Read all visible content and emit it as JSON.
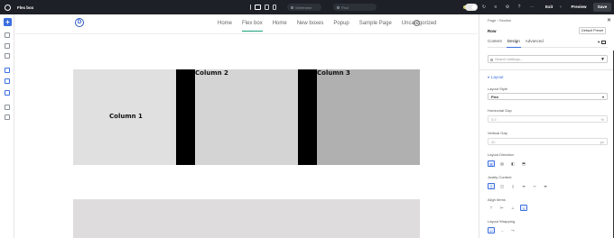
{
  "topbar": {
    "page_name": "Flex box",
    "wireframe_label": "Wireframe",
    "find_label": "Find",
    "exit_label": "Exit",
    "preview_label": "Preview",
    "save_label": "Save"
  },
  "site": {
    "logo_letter": "D",
    "nav": [
      "Home",
      "Flex box",
      "Home",
      "New boxes",
      "Popup",
      "Sample Page",
      "Uncategorized"
    ],
    "active_nav_index": 1
  },
  "canvas": {
    "columns": [
      {
        "label": "Column 1"
      },
      {
        "label": "Column 2"
      },
      {
        "label": "Column 3"
      }
    ]
  },
  "panel": {
    "breadcrumb": "Page › Section",
    "title": "Row",
    "preset_label": "Default Preset",
    "tabs": [
      "Content",
      "Design",
      "Advanced"
    ],
    "active_tab": "Design",
    "search_placeholder": "Search settings...",
    "section_title": "Layout",
    "layout_style_label": "Layout Style",
    "layout_style_value": "Flex",
    "horizontal_gap_label": "Horizontal Gap",
    "horizontal_gap_value": "5.5",
    "horizontal_gap_unit": "%",
    "vertical_gap_label": "Vertical Gap",
    "vertical_gap_value": "40",
    "vertical_gap_unit": "px",
    "layout_direction_label": "Layout Direction",
    "justify_content_label": "Justify Content",
    "align_items_label": "Align Items",
    "layout_wrapping_label": "Layout Wrapping"
  },
  "colors": {
    "accent": "#3b6fe0",
    "topbar_bg": "#1d2127",
    "nav_active_underline": "#1aa37a"
  }
}
